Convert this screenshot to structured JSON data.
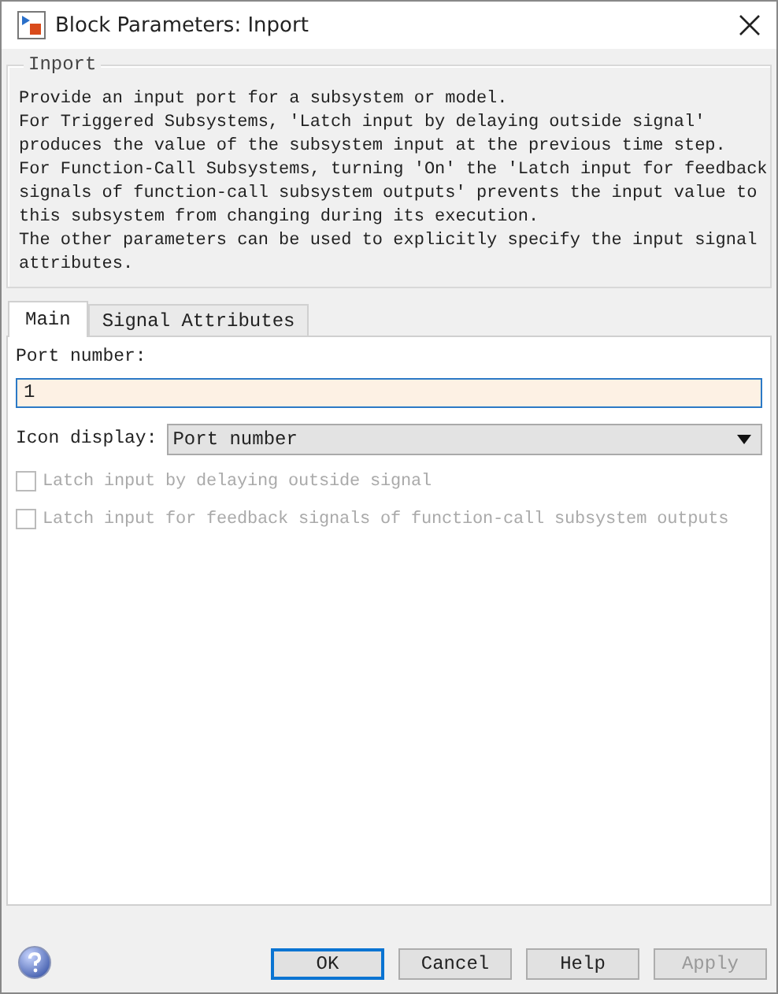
{
  "window": {
    "title": "Block Parameters: Inport"
  },
  "description": {
    "title": "Inport",
    "lines": [
      "Provide an input port for a subsystem or model.",
      "For Triggered Subsystems, 'Latch input by delaying outside signal'",
      "produces the value of the subsystem input at the previous time step.",
      "For Function-Call Subsystems, turning 'On' the 'Latch input for feedback",
      "signals of function-call subsystem outputs' prevents the input value to",
      "this subsystem from changing during its execution.",
      "The other parameters can be used to explicitly specify the input signal",
      "attributes."
    ]
  },
  "tabs": [
    {
      "label": "Main",
      "selected": true
    },
    {
      "label": "Signal Attributes",
      "selected": false
    }
  ],
  "port_number": {
    "label": "Port number:",
    "value": "1"
  },
  "icon_display": {
    "label": "Icon display:",
    "value": "Port number"
  },
  "checkboxes": [
    {
      "label": "Latch input by delaying outside signal",
      "checked": false,
      "disabled": true
    },
    {
      "label": "Latch input for feedback signals of function-call subsystem outputs",
      "checked": false,
      "disabled": true
    }
  ],
  "buttons": [
    {
      "label": "OK",
      "default": true,
      "disabled": false
    },
    {
      "label": "Cancel",
      "default": false,
      "disabled": false
    },
    {
      "label": "Help",
      "default": false,
      "disabled": false
    },
    {
      "label": "Apply",
      "default": false,
      "disabled": true
    }
  ]
}
